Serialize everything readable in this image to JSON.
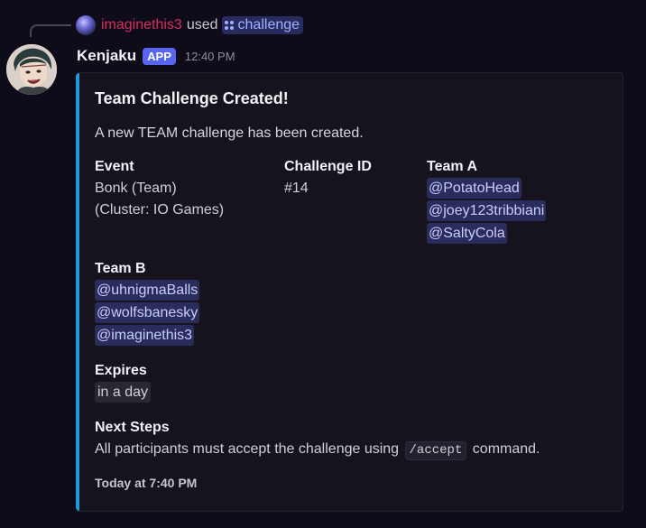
{
  "reply": {
    "username": "imaginethis3",
    "used_text": "used",
    "command": "challenge",
    "avatar_icon": "user-avatar-icon"
  },
  "message": {
    "author": "Kenjaku",
    "badge": "APP",
    "timestamp": "12:40 PM",
    "avatar_icon": "bot-avatar-icon"
  },
  "embed": {
    "accent_color": "#1e9bd8",
    "title": "Team Challenge Created!",
    "description": "A new TEAM challenge has been created.",
    "fields": {
      "event": {
        "name": "Event",
        "lines": [
          "Bonk (Team)",
          "(Cluster: IO Games)"
        ]
      },
      "challenge_id": {
        "name": "Challenge ID",
        "value": "#14"
      },
      "team_a": {
        "name": "Team A",
        "members": [
          "@PotatoHead",
          "@joey123tribbiani",
          "@SaltyCola"
        ]
      },
      "team_b": {
        "name": "Team B",
        "members": [
          "@uhnigmaBalls",
          "@wolfsbanesky",
          "@imaginethis3"
        ]
      },
      "expires": {
        "name": "Expires",
        "value": "in a day"
      },
      "next_steps": {
        "name": "Next Steps",
        "text_before": "All participants must accept the challenge using",
        "code": "/accept",
        "text_after": "command."
      }
    },
    "footer": "Today at 7:40 PM"
  },
  "colors": {
    "background": "#0f0c19",
    "mention_bg": "#2a2d5c",
    "mention_text": "#c8cdff",
    "reply_username": "#d62c63",
    "app_badge": "#5865f2"
  }
}
